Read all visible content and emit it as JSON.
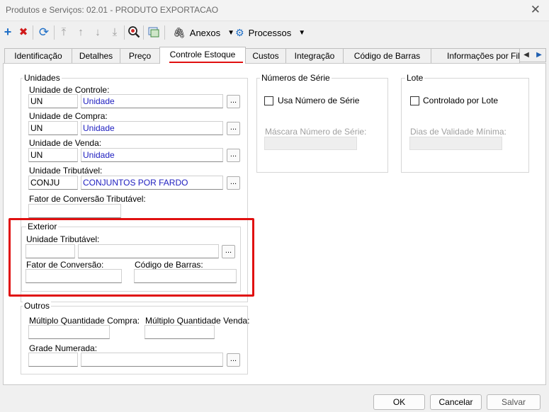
{
  "window": {
    "title": "Produtos e Serviços: 02.01 - PRODUTO EXPORTACAO"
  },
  "toolbar": {
    "icons": [
      "plus-icon",
      "delete-icon",
      "refresh-icon",
      "first-icon",
      "up-icon",
      "down-icon",
      "last-icon",
      "search-icon",
      "export-icon"
    ],
    "anexos_label": "Anexos",
    "processos_label": "Processos"
  },
  "tabs": [
    "Identificação",
    "Detalhes",
    "Preço",
    "Controle Estoque",
    "Custos",
    "Integração",
    "Código de Barras",
    "Informações por Fili"
  ],
  "active_tab": "Controle Estoque",
  "unidades": {
    "title": "Unidades",
    "controle": {
      "label": "Unidade de Controle:",
      "code": "UN",
      "desc": "Unidade"
    },
    "compra": {
      "label": "Unidade de Compra:",
      "code": "UN",
      "desc": "Unidade"
    },
    "venda": {
      "label": "Unidade de Venda:",
      "code": "UN",
      "desc": "Unidade"
    },
    "tributavel": {
      "label": "Unidade Tributável:",
      "code": "CONJU",
      "desc": "CONJUNTOS POR FARDO"
    },
    "fator_label": "Fator de Conversão Tributável:",
    "dots": "..."
  },
  "exterior": {
    "title": "Exterior",
    "unidade_label": "Unidade Tributável:",
    "fator_label": "Fator de Conversão:",
    "codigo_label": "Código de Barras:"
  },
  "outros": {
    "title": "Outros",
    "compra_label": "Múltiplo Quantidade Compra:",
    "venda_label": "Múltiplo Quantidade Venda:",
    "grade_label": "Grade Numerada:"
  },
  "serie": {
    "title": "Números de Série",
    "checkbox_label": "Usa Número de Série",
    "mascara_label": "Máscara Número de Série:"
  },
  "lote": {
    "title": "Lote",
    "checkbox_label": "Controlado por Lote",
    "dias_label": "Dias de Validade Mínima:"
  },
  "footer": {
    "ok": "OK",
    "cancel": "Cancelar",
    "save": "Salvar"
  },
  "colors": {
    "link_text": "#2020c0",
    "highlight": "#e01010"
  }
}
